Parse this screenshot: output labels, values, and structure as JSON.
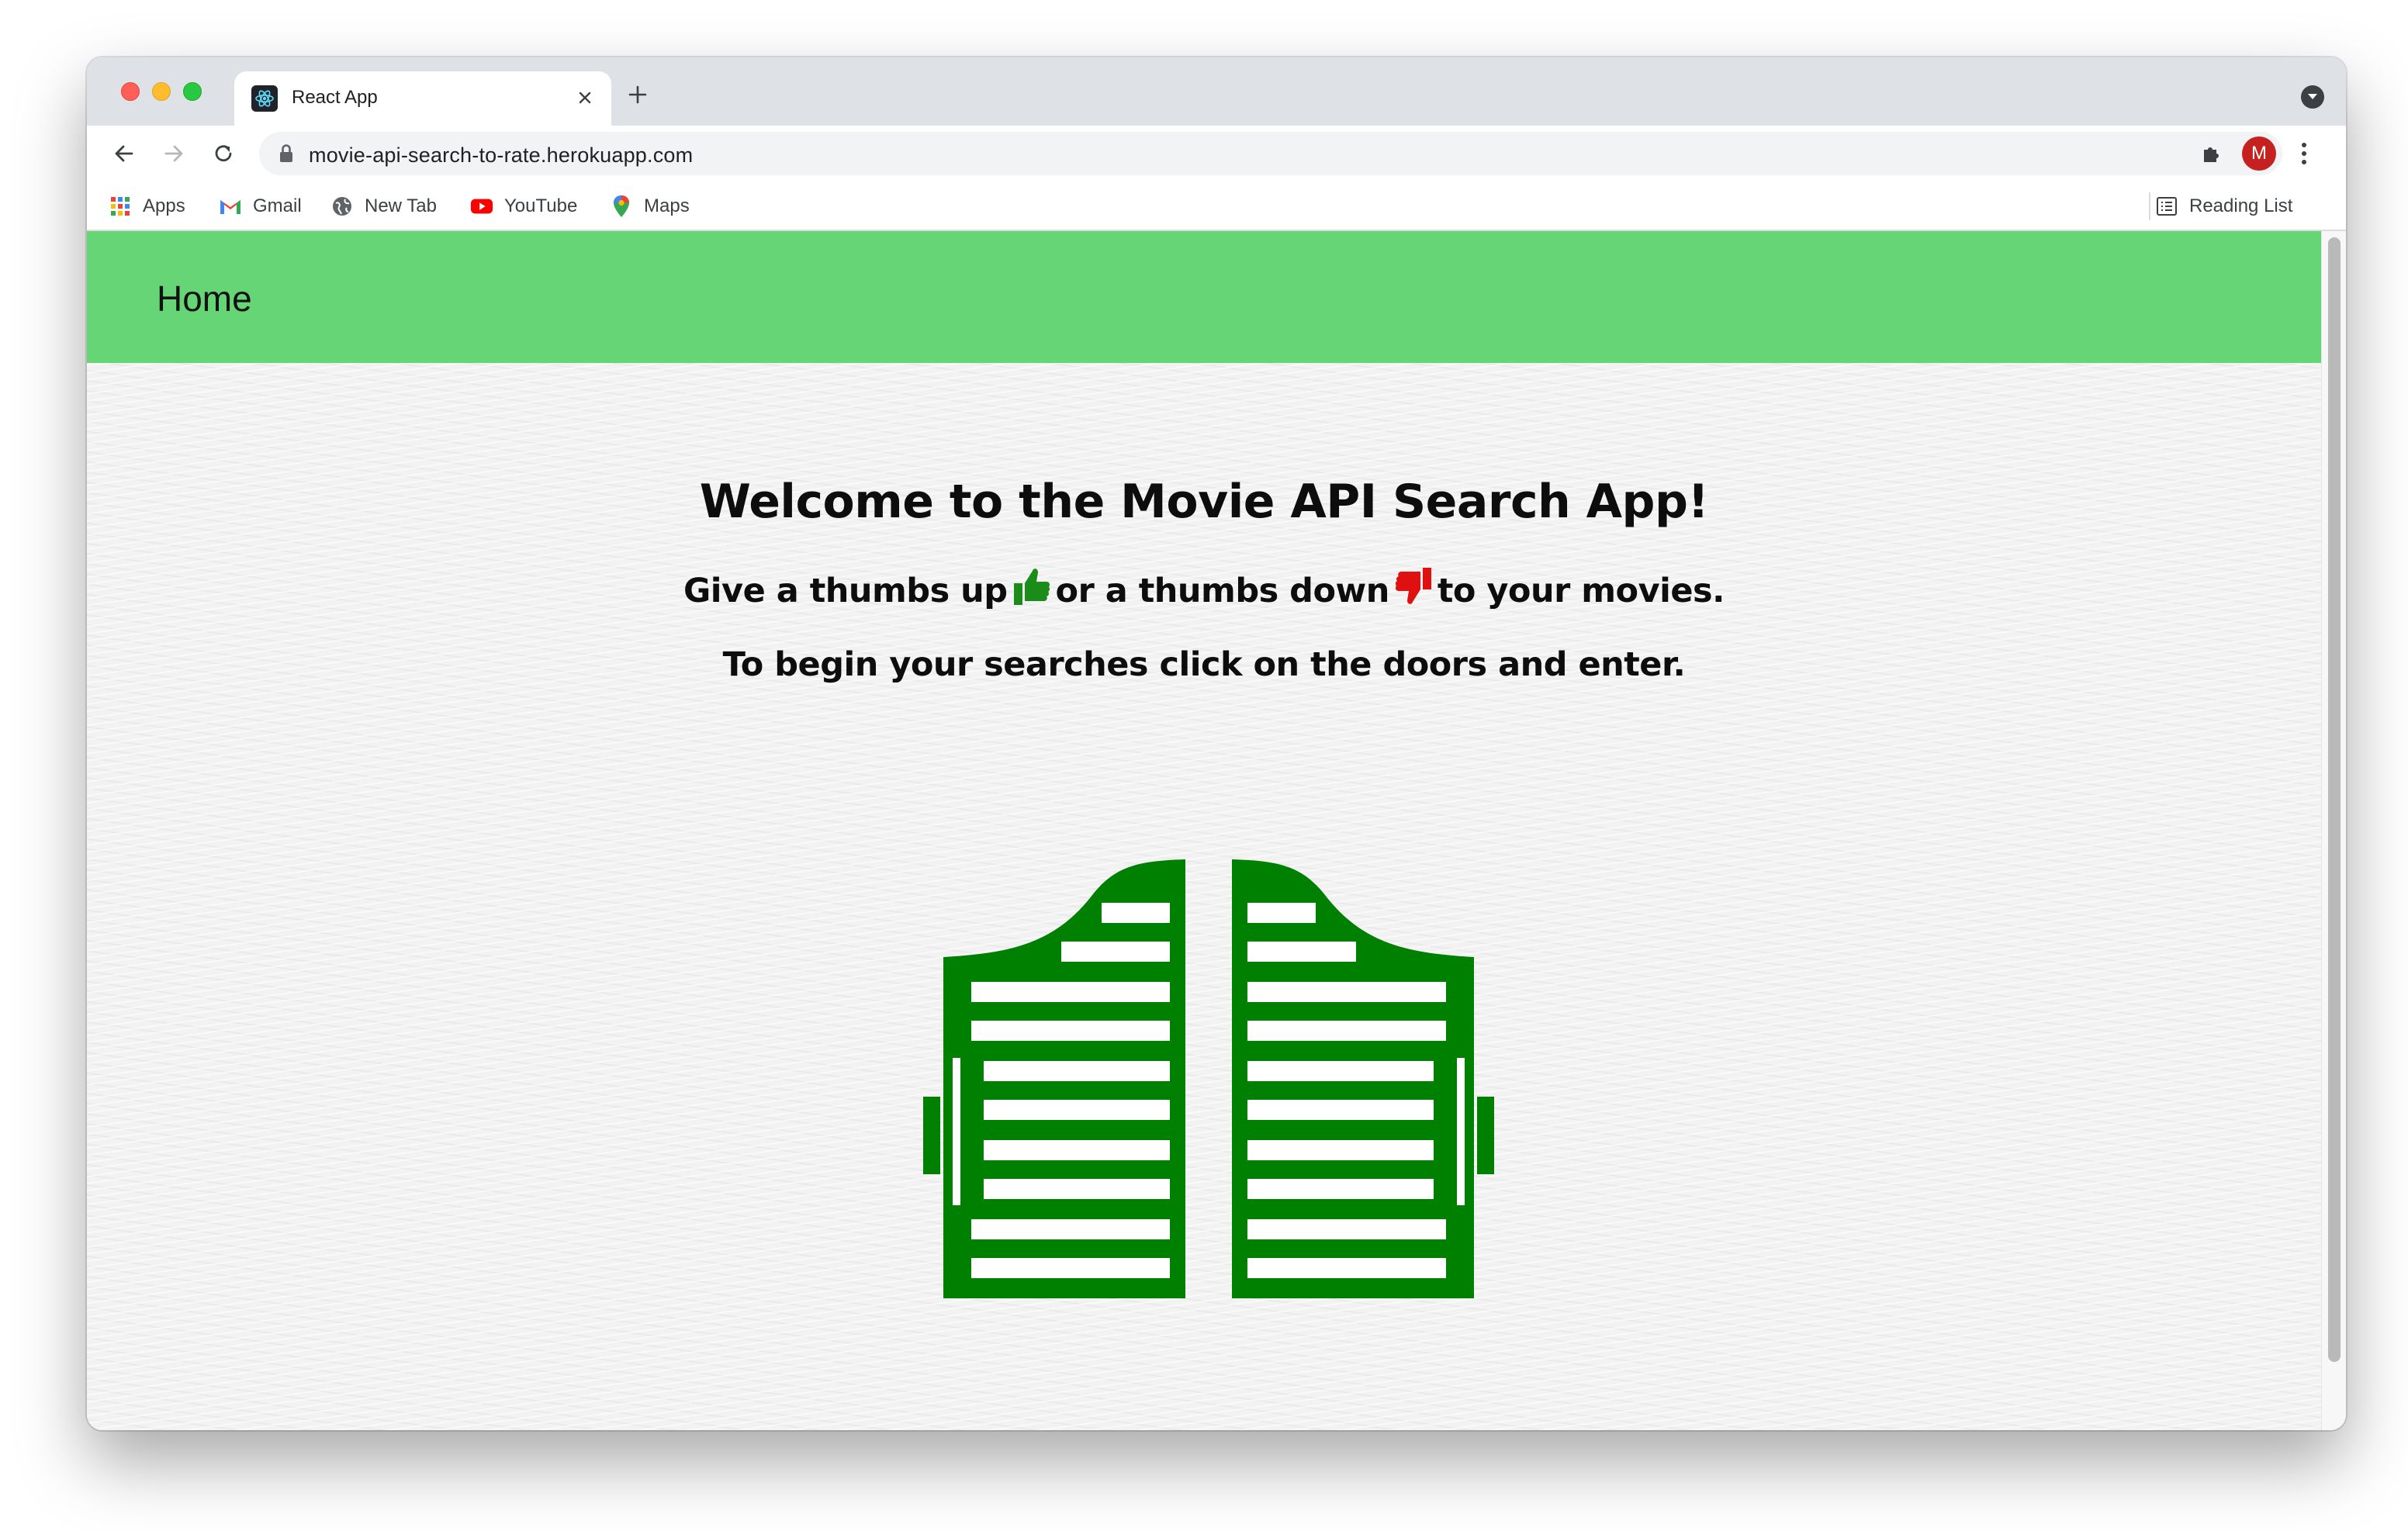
{
  "browser": {
    "tab_title": "React App",
    "url": "movie-api-search-to-rate.herokuapp.com",
    "profile_initial": "M",
    "bookmarks": [
      {
        "label": "Apps",
        "icon": "apps-grid-icon"
      },
      {
        "label": "Gmail",
        "icon": "gmail-icon"
      },
      {
        "label": "New Tab",
        "icon": "globe-icon"
      },
      {
        "label": "YouTube",
        "icon": "youtube-icon"
      },
      {
        "label": "Maps",
        "icon": "maps-pin-icon"
      }
    ],
    "reading_list": "Reading List"
  },
  "page": {
    "nav": {
      "home_label": "Home",
      "bg_color": "#66d575"
    },
    "heading": "Welcome to the Movie API Search App!",
    "subtitle_part1": "Give a thumbs up",
    "subtitle_part2": "or a thumbs down",
    "subtitle_part3": "to your movies.",
    "instruction": "To begin your searches click on the doors and enter.",
    "thumbs_up_color": "#1a8c1a",
    "thumbs_down_color": "#e01010",
    "doors_color": "#008000",
    "doors_icon": "saloon-doors-icon"
  }
}
